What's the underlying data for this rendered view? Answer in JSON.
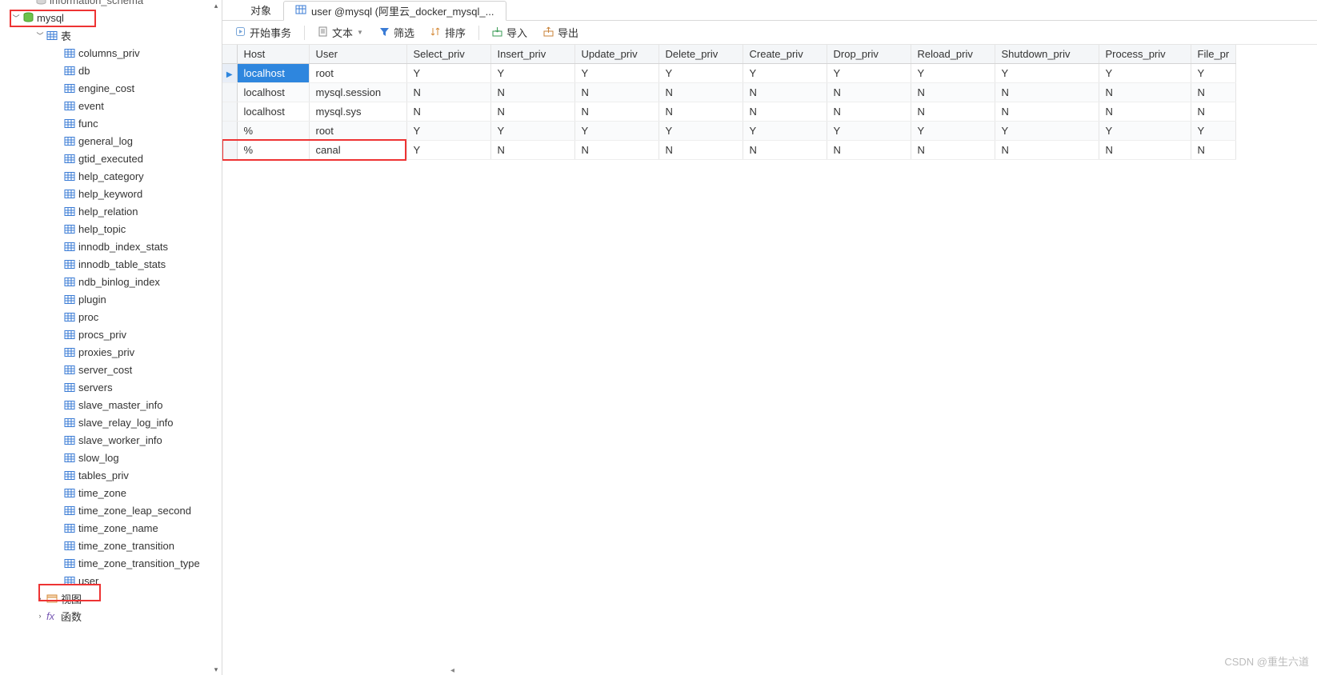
{
  "sidebar": {
    "top_item": "information_schema",
    "db": "mysql",
    "folder_tables": "表",
    "tables": [
      "columns_priv",
      "db",
      "engine_cost",
      "event",
      "func",
      "general_log",
      "gtid_executed",
      "help_category",
      "help_keyword",
      "help_relation",
      "help_topic",
      "innodb_index_stats",
      "innodb_table_stats",
      "ndb_binlog_index",
      "plugin",
      "proc",
      "procs_priv",
      "proxies_priv",
      "server_cost",
      "servers",
      "slave_master_info",
      "slave_relay_log_info",
      "slave_worker_info",
      "slow_log",
      "tables_priv",
      "time_zone",
      "time_zone_leap_second",
      "time_zone_name",
      "time_zone_transition",
      "time_zone_transition_type",
      "user"
    ],
    "folder_views": "视图",
    "folder_functions": "函数"
  },
  "tabs": {
    "t0": "对象",
    "t1": "user @mysql (阿里云_docker_mysql_..."
  },
  "toolbar": {
    "begin_tx": "开始事务",
    "text": "文本",
    "filter": "筛选",
    "sort": "排序",
    "import": "导入",
    "export": "导出"
  },
  "grid": {
    "columns": [
      "Host",
      "User",
      "Select_priv",
      "Insert_priv",
      "Update_priv",
      "Delete_priv",
      "Create_priv",
      "Drop_priv",
      "Reload_priv",
      "Shutdown_priv",
      "Process_priv",
      "File_pr"
    ],
    "rows": [
      {
        "Host": "localhost",
        "User": "root",
        "v": [
          "Y",
          "Y",
          "Y",
          "Y",
          "Y",
          "Y",
          "Y",
          "Y",
          "Y",
          "Y"
        ]
      },
      {
        "Host": "localhost",
        "User": "mysql.session",
        "v": [
          "N",
          "N",
          "N",
          "N",
          "N",
          "N",
          "N",
          "N",
          "N",
          "N"
        ]
      },
      {
        "Host": "localhost",
        "User": "mysql.sys",
        "v": [
          "N",
          "N",
          "N",
          "N",
          "N",
          "N",
          "N",
          "N",
          "N",
          "N"
        ]
      },
      {
        "Host": "%",
        "User": "root",
        "v": [
          "Y",
          "Y",
          "Y",
          "Y",
          "Y",
          "Y",
          "Y",
          "Y",
          "Y",
          "Y"
        ]
      },
      {
        "Host": "%",
        "User": "canal",
        "v": [
          "Y",
          "N",
          "N",
          "N",
          "N",
          "N",
          "N",
          "N",
          "N",
          "N"
        ]
      }
    ]
  },
  "watermark": "CSDN @重生六道"
}
